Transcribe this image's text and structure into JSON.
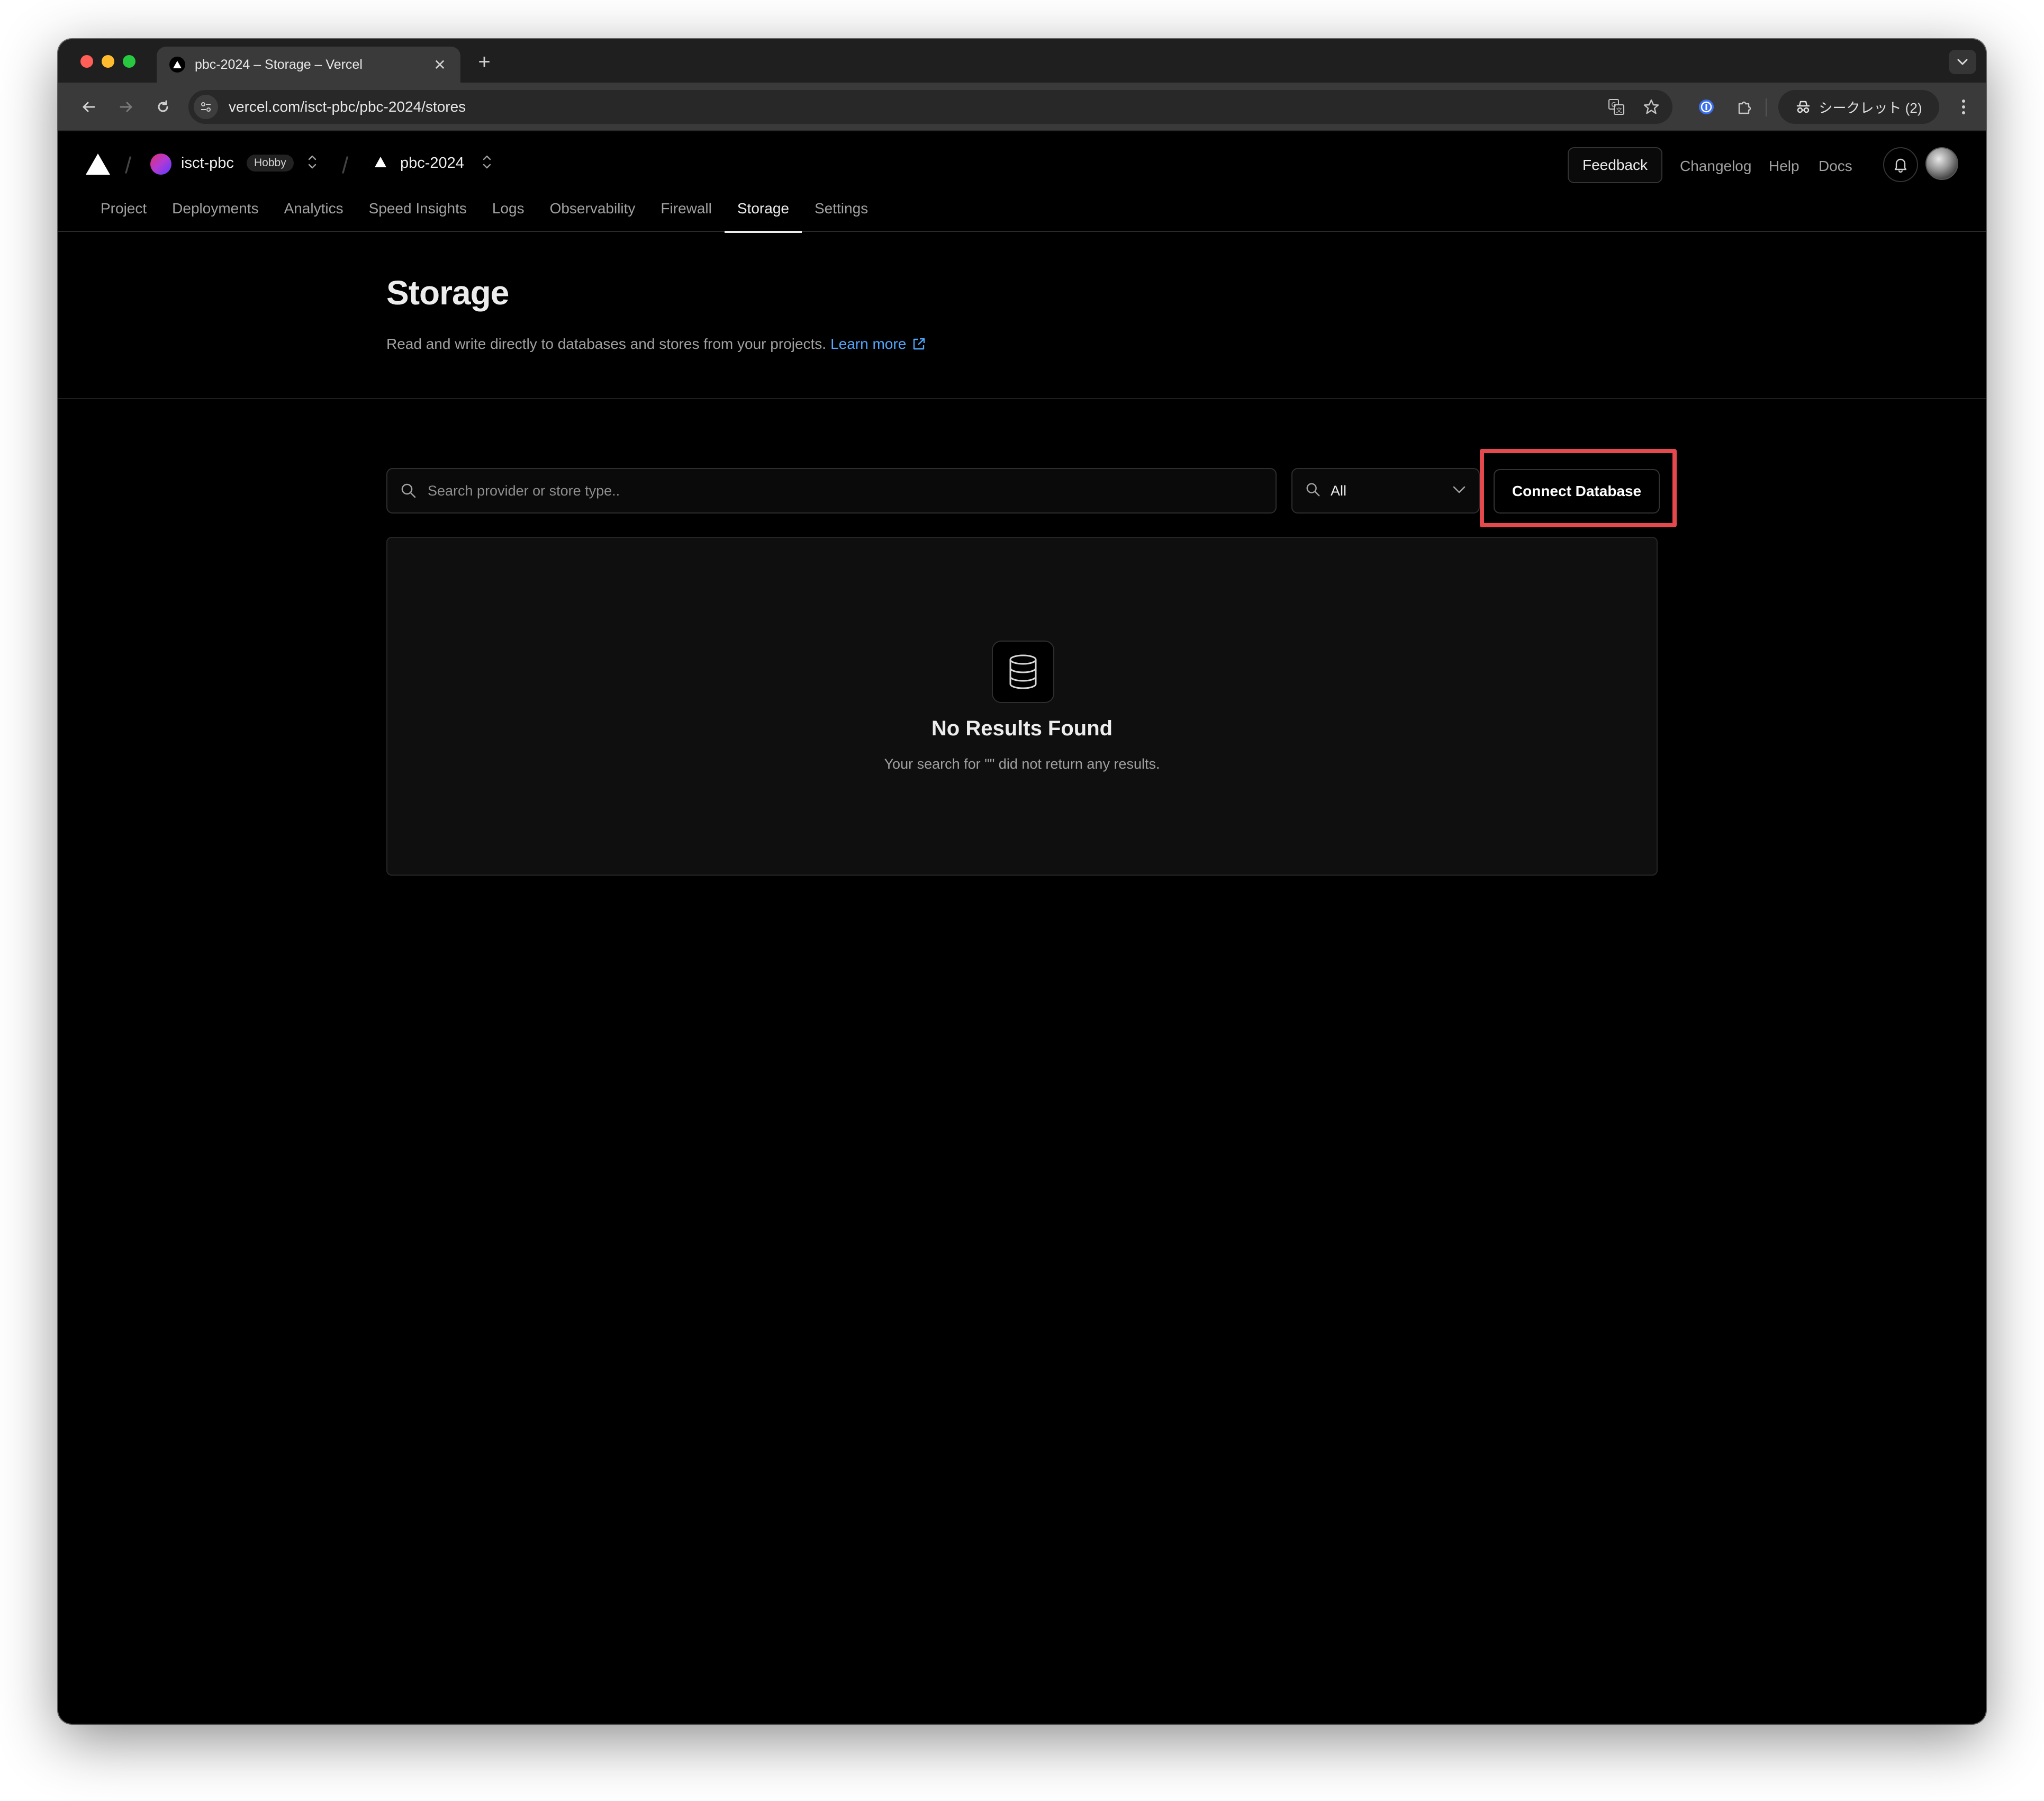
{
  "browser": {
    "tab_title": "pbc-2024 – Storage – Vercel",
    "tab_close": "✕",
    "new_tab": "+",
    "url": "vercel.com/isct-pbc/pbc-2024/stores",
    "incognito_label": "シークレット (2)",
    "icons": [
      "back-icon",
      "forward-icon",
      "reload-icon",
      "site-info-icon",
      "translate-icon",
      "star-icon",
      "password-manager-icon",
      "extensions-icon",
      "incognito-icon",
      "kebab-menu-icon",
      "tab-list-icon"
    ]
  },
  "header": {
    "team_name": "isct-pbc",
    "plan_badge": "Hobby",
    "project_name": "pbc-2024",
    "feedback": "Feedback",
    "changelog": "Changelog",
    "help": "Help",
    "docs": "Docs"
  },
  "nav": {
    "tabs": [
      {
        "label": "Project"
      },
      {
        "label": "Deployments"
      },
      {
        "label": "Analytics"
      },
      {
        "label": "Speed Insights"
      },
      {
        "label": "Logs"
      },
      {
        "label": "Observability"
      },
      {
        "label": "Firewall"
      },
      {
        "label": "Storage",
        "active": true
      },
      {
        "label": "Settings"
      }
    ]
  },
  "page": {
    "title": "Storage",
    "description": "Read and write directly to databases and stores from your projects.",
    "learn_more": "Learn more"
  },
  "controls": {
    "search_placeholder": "Search provider or store type..",
    "search_value": "",
    "filter_value": "All",
    "connect_button": "Connect Database"
  },
  "empty_state": {
    "title": "No Results Found",
    "message": "Your search for \"\" did not return any results."
  },
  "colors": {
    "background": "#000000",
    "text_primary": "#ededed",
    "text_secondary": "#a1a1a1",
    "link": "#52a8ff",
    "highlight": "#e5484d"
  }
}
